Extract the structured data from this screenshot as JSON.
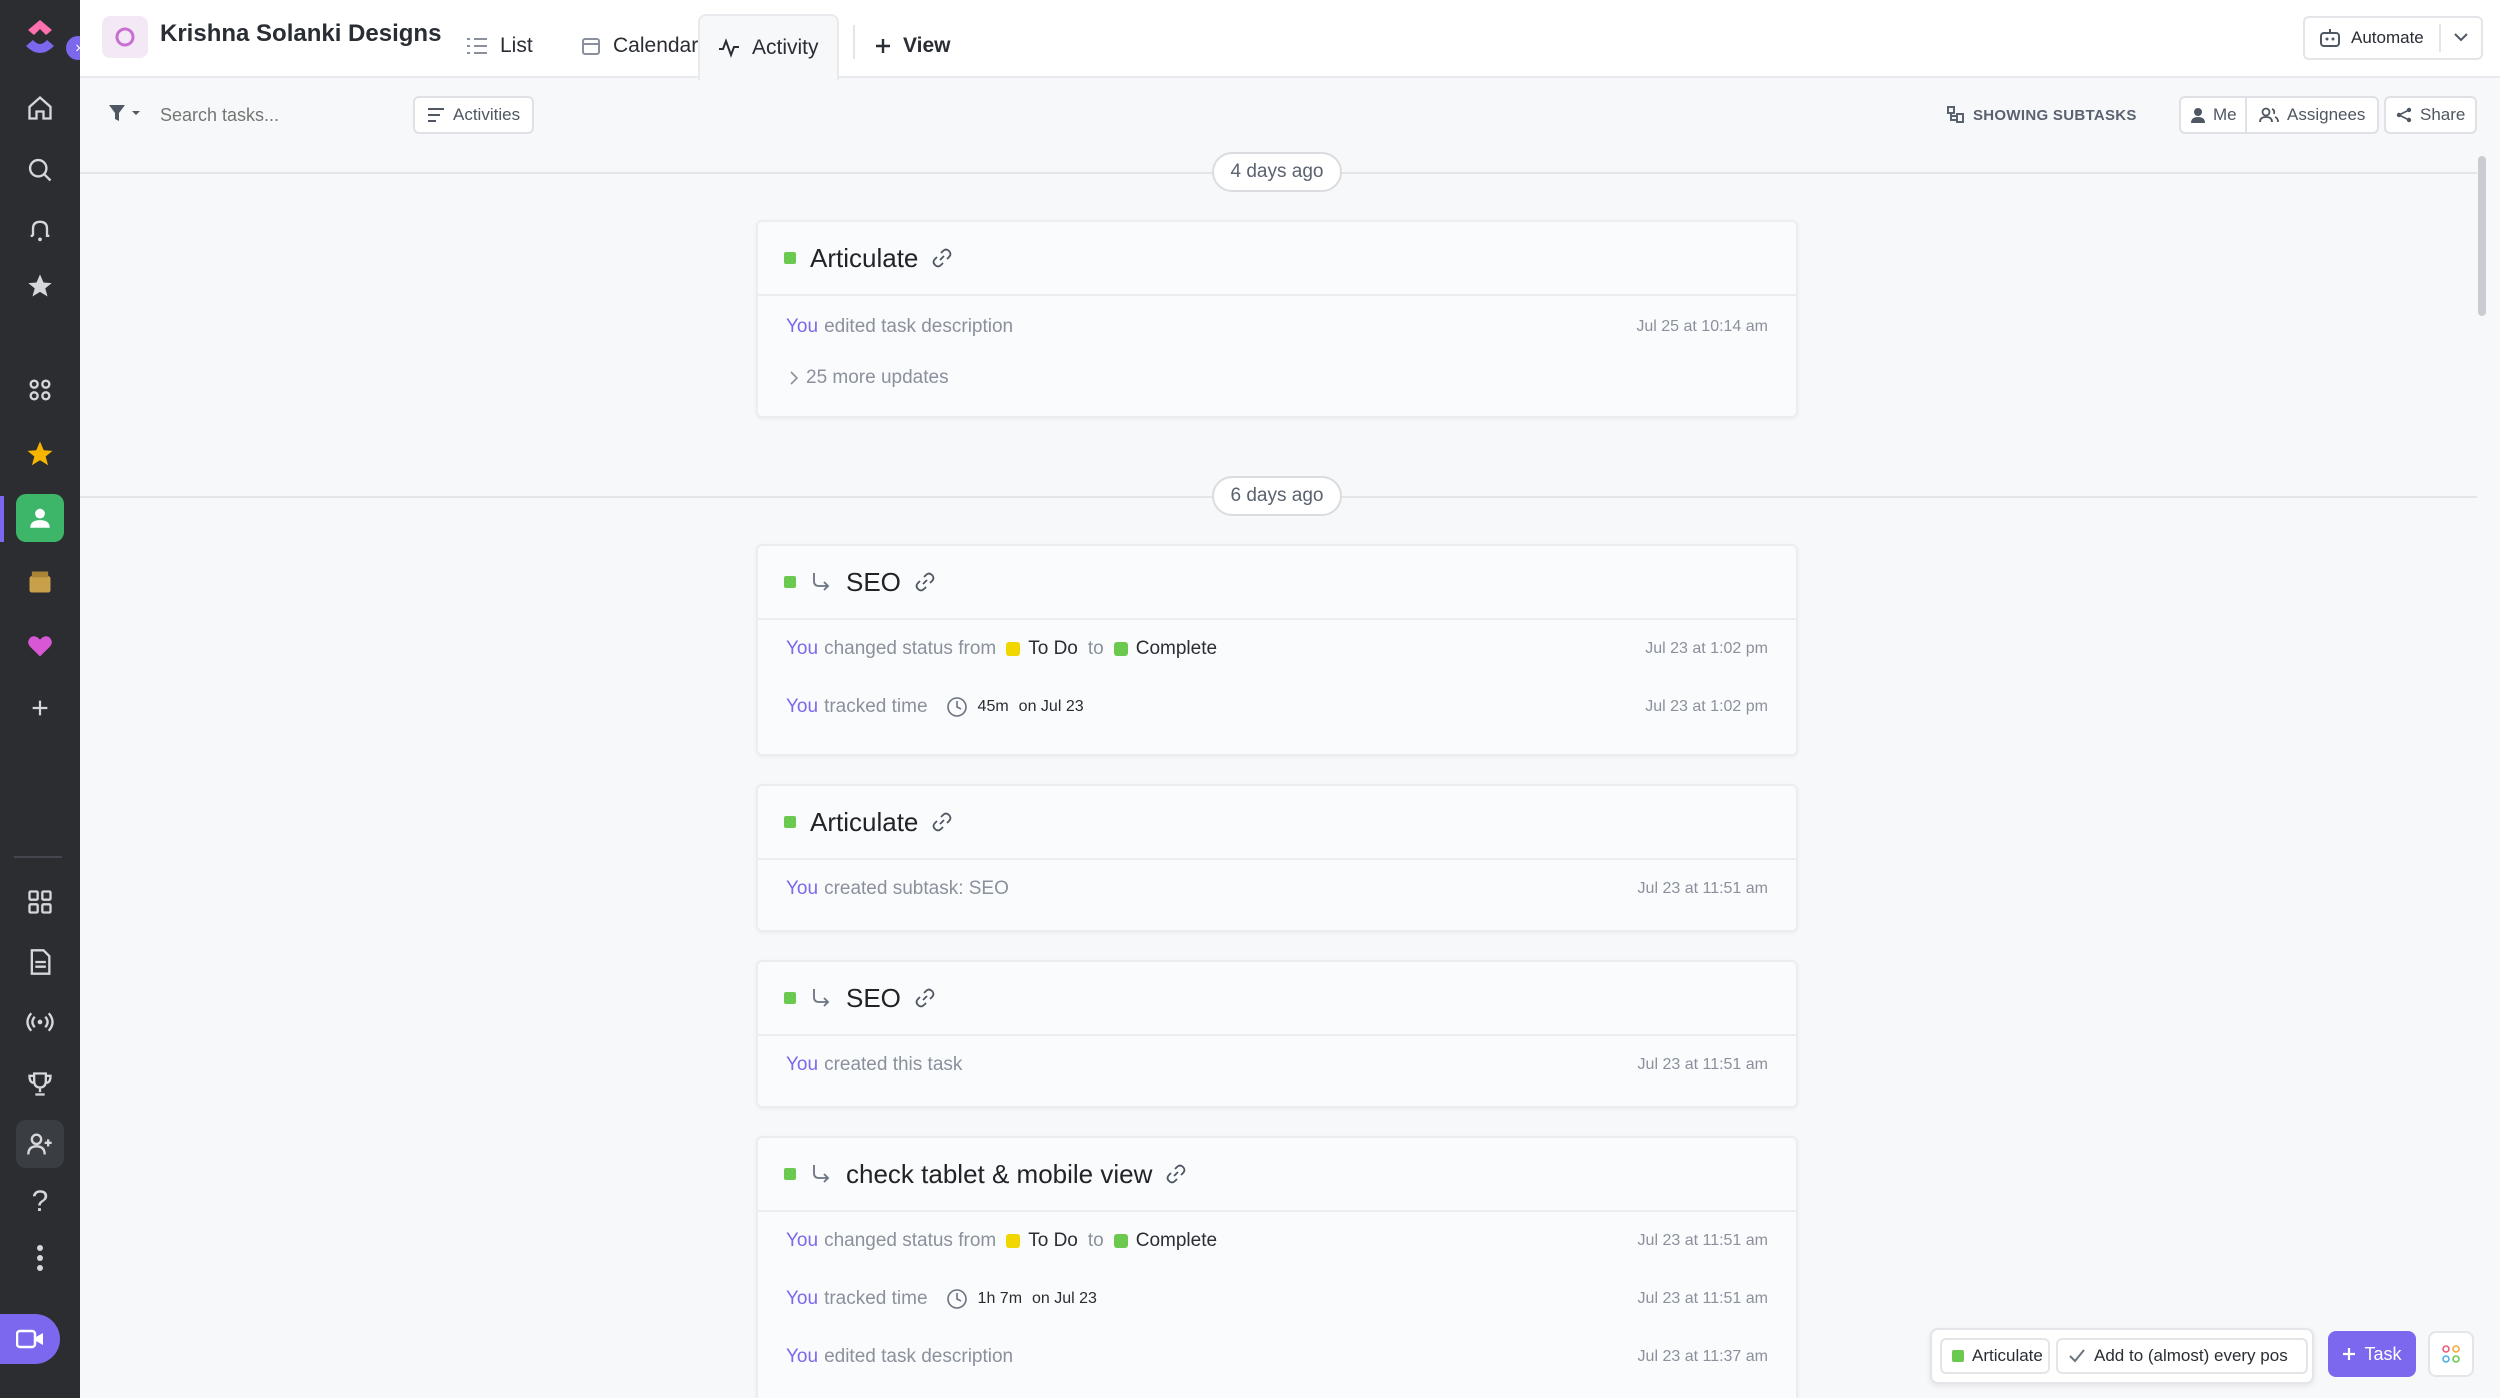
{
  "workspace": {
    "name": "Krishna Solanki Designs"
  },
  "tabs": [
    {
      "label": "List"
    },
    {
      "label": "Calendar"
    },
    {
      "label": "Activity"
    }
  ],
  "add_view_label": "View",
  "automate_label": "Automate",
  "search": {
    "placeholder": "Search tasks..."
  },
  "toolbar": {
    "activities_label": "Activities",
    "showing_subtasks_label": "SHOWING SUBTASKS",
    "me_label": "Me",
    "assignees_label": "Assignees",
    "share_label": "Share"
  },
  "groups": [
    {
      "label": "4 days ago"
    },
    {
      "label": "6 days ago"
    }
  ],
  "cards": [
    {
      "title": "Articulate",
      "rows": [
        {
          "actor": "You",
          "text": "edited task description",
          "time": "Jul 25 at 10:14 am"
        }
      ],
      "more_updates": "25 more updates"
    },
    {
      "title": "SEO",
      "rows": [
        {
          "actor": "You",
          "text": "changed status from",
          "from": "To Do",
          "to_word": "to",
          "to": "Complete",
          "time": "Jul 23 at 1:02 pm"
        },
        {
          "actor": "You",
          "text": "tracked time",
          "duration": "45m",
          "on": "on Jul 23",
          "time": "Jul 23 at 1:02 pm"
        }
      ]
    },
    {
      "title": "Articulate",
      "rows": [
        {
          "actor": "You",
          "text": "created subtask: SEO",
          "time": "Jul 23 at 11:51 am"
        }
      ]
    },
    {
      "title": "SEO",
      "rows": [
        {
          "actor": "You",
          "text": "created this task",
          "time": "Jul 23 at 11:51 am"
        }
      ]
    },
    {
      "title": "check tablet & mobile view",
      "rows": [
        {
          "actor": "You",
          "text": "changed status from",
          "from": "To Do",
          "to_word": "to",
          "to": "Complete",
          "time": "Jul 23 at 11:51 am"
        },
        {
          "actor": "You",
          "text": "tracked time",
          "duration": "1h 7m",
          "on": "on Jul 23",
          "time": "Jul 23 at 11:51 am"
        },
        {
          "actor": "You",
          "text": "edited task description",
          "time": "Jul 23 at 11:37 am"
        }
      ]
    }
  ],
  "tray": {
    "item1": "Articulate",
    "item2": "Add to (almost) every pos",
    "task_button": "Task"
  },
  "colors": {
    "accent": "#7b68ee",
    "todo": "#f2d600",
    "complete": "#6bc950",
    "sidebar": "#2b2d31"
  }
}
